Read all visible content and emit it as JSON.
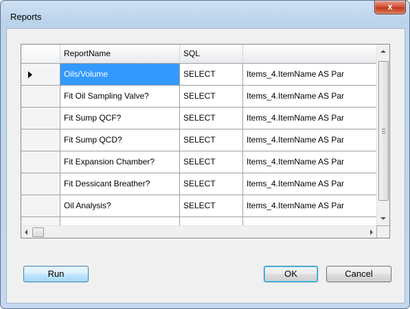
{
  "window": {
    "title": "Reports",
    "close_label": "x"
  },
  "grid": {
    "columns": [
      "ReportName",
      "SQL"
    ],
    "rows": [
      {
        "name": "Oils/Volume",
        "sql": "SELECT",
        "sql_more": "Items_4.ItemName AS Par"
      },
      {
        "name": "Fit Oil Sampling Valve?",
        "sql": "SELECT",
        "sql_more": "Items_4.ItemName AS Par"
      },
      {
        "name": "Fit Sump QCF?",
        "sql": "SELECT",
        "sql_more": "Items_4.ItemName AS Par"
      },
      {
        "name": "Fit Sump QCD?",
        "sql": "SELECT",
        "sql_more": "Items_4.ItemName AS Par"
      },
      {
        "name": "Fit Expansion Chamber?",
        "sql": "SELECT",
        "sql_more": "Items_4.ItemName AS Par"
      },
      {
        "name": "Fit Dessicant Breather?",
        "sql": "SELECT",
        "sql_more": "Items_4.ItemName AS Par"
      },
      {
        "name": "Oil Analysis?",
        "sql": "SELECT",
        "sql_more": "Items_4.ItemName AS Par"
      }
    ],
    "selected_index": 0
  },
  "buttons": {
    "run": "Run",
    "ok": "OK",
    "cancel": "Cancel"
  },
  "colors": {
    "selection": "#3399ff",
    "close_button": "#c23a20"
  }
}
